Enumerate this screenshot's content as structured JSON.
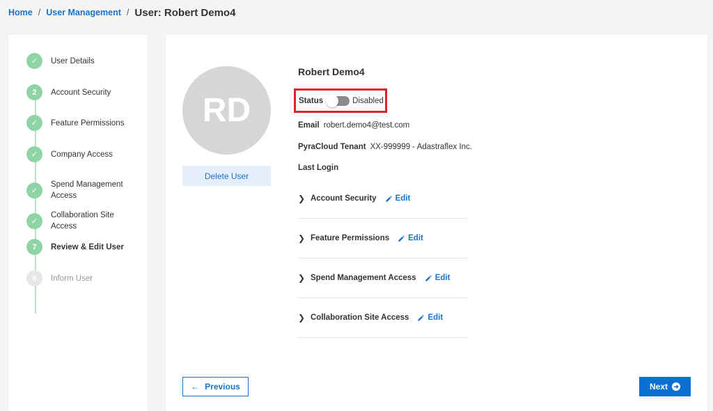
{
  "breadcrumb": {
    "home": "Home",
    "sep1": "/",
    "user_management": "User Management",
    "sep2": "/",
    "current": "User: Robert Demo4"
  },
  "steps": [
    {
      "marker": "✓",
      "label": "User Details",
      "state": "complete"
    },
    {
      "marker": "2",
      "label": "Account Security",
      "state": "complete"
    },
    {
      "marker": "✓",
      "label": "Feature Permissions",
      "state": "complete"
    },
    {
      "marker": "✓",
      "label": "Company Access",
      "state": "complete"
    },
    {
      "marker": "✓",
      "label": "Spend Management Access",
      "state": "complete"
    },
    {
      "marker": "✓",
      "label": "Collaboration Site Access",
      "state": "complete"
    },
    {
      "marker": "7",
      "label": "Review & Edit User",
      "state": "active"
    },
    {
      "marker": "8",
      "label": "Inform User",
      "state": "pending"
    }
  ],
  "avatar_initials": "RD",
  "delete_label": "Delete User",
  "user": {
    "name": "Robert Demo4",
    "status_label": "Status",
    "status_value": "Disabled",
    "email_label": "Email",
    "email": "robert.demo4@test.com",
    "tenant_label": "PyraCloud Tenant",
    "tenant": "XX-999999 - Adastraflex Inc.",
    "last_login_label": "Last Login"
  },
  "sections": [
    {
      "title": "Account Security",
      "edit": "Edit"
    },
    {
      "title": "Feature Permissions",
      "edit": "Edit"
    },
    {
      "title": "Spend Management Access",
      "edit": "Edit"
    },
    {
      "title": "Collaboration Site Access",
      "edit": "Edit"
    }
  ],
  "previous_label": "Previous",
  "next_label": "Next",
  "colors": {
    "accent": "#1a73c8",
    "highlight_border": "#e0202a",
    "step_complete": "#8fd4a5"
  }
}
